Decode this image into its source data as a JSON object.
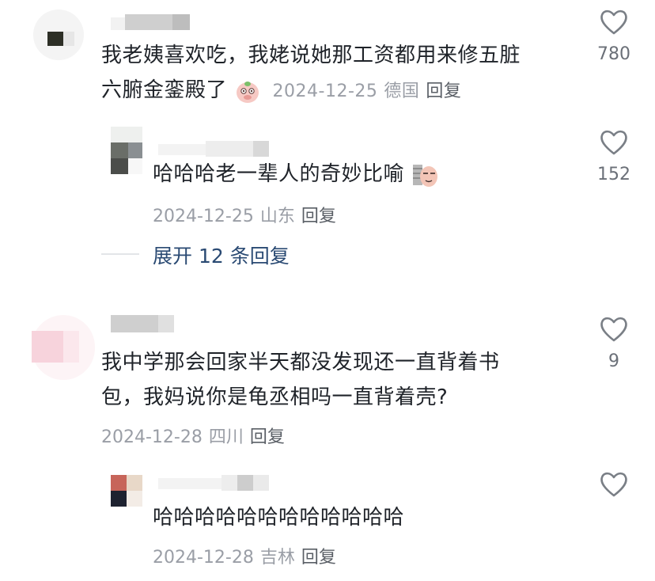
{
  "comments": [
    {
      "text_line1": "我老姨喜欢吃，我姥说她那工资都用来修五脏",
      "text_line2": "六腑金銮殿了",
      "emoji": "pig-sticker-icon",
      "date": "2024-12-25",
      "location": "德国",
      "reply_label": "回复",
      "likes": "780",
      "replies": [
        {
          "text": "哈哈哈老一辈人的奇妙比喻",
          "emoji": "smug-face-sticker-icon",
          "date": "2024-12-25",
          "location": "山东",
          "reply_label": "回复",
          "likes": "152"
        }
      ],
      "expand_label": "展开 12 条回复"
    },
    {
      "text_line1": "我中学那会回家半天都没发现还一直背着书",
      "text_line2": "包，我妈说你是龟丞相吗一直背着壳?",
      "date": "2024-12-28",
      "location": "四川",
      "reply_label": "回复",
      "likes": "9",
      "replies": [
        {
          "text": "哈哈哈哈哈哈哈哈哈哈哈哈",
          "date": "2024-12-28",
          "location": "吉林",
          "reply_label": "回复",
          "likes": ""
        }
      ]
    }
  ],
  "colors": {
    "text": "#1f2329",
    "meta": "#9a9ea6",
    "link": "#2a4a73",
    "heart": "#7a7f86"
  }
}
